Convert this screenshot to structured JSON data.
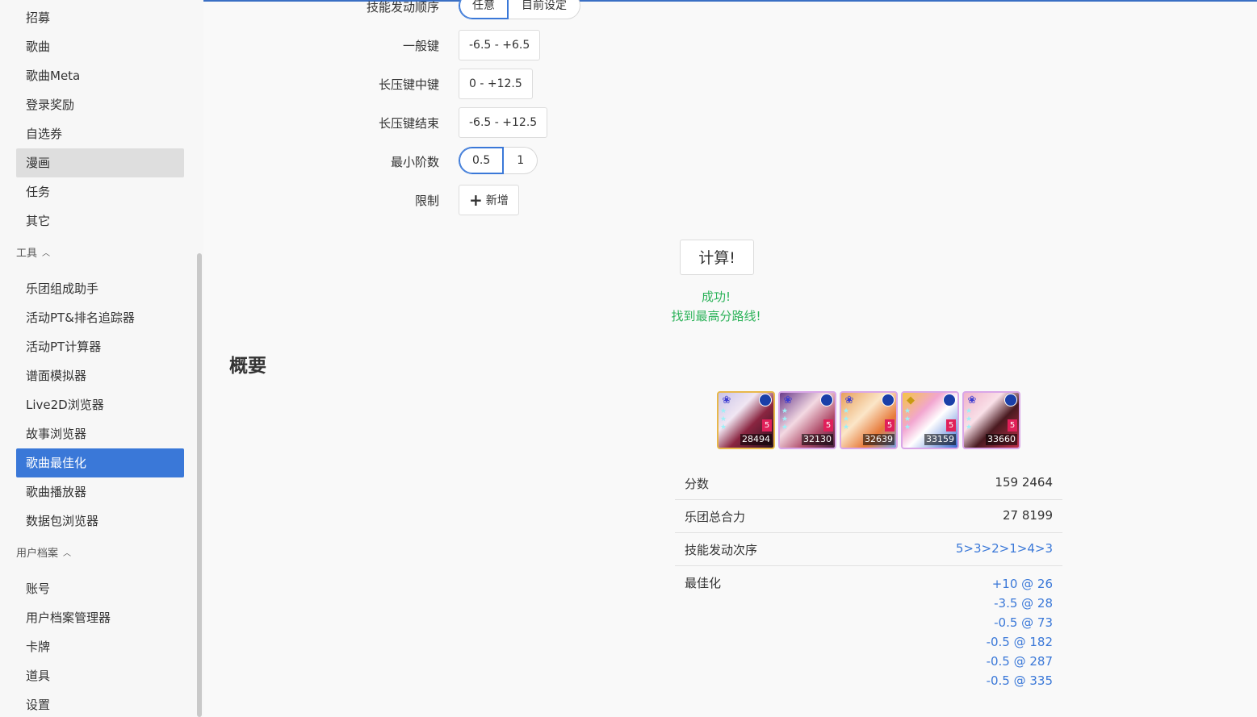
{
  "sidebar": {
    "items_top": [
      "招募",
      "歌曲",
      "歌曲Meta",
      "登录奖励",
      "自选券",
      "漫画",
      "任务",
      "其它"
    ],
    "section_tools": "工具",
    "items_tools": [
      "乐团组成助手",
      "活动PT&排名追踪器",
      "活动PT计算器",
      "谱面模拟器",
      "Live2D浏览器",
      "故事浏览器",
      "歌曲最佳化",
      "歌曲播放器",
      "数据包浏览器"
    ],
    "section_profile": "用户档案",
    "items_profile": [
      "账号",
      "用户档案管理器",
      "卡牌",
      "道具",
      "设置"
    ]
  },
  "form": {
    "skill_order_label": "技能发动顺序",
    "skill_order_options": [
      "任意",
      "目前设定"
    ],
    "normal_note_label": "一般键",
    "normal_note_value": "-6.5 - +6.5",
    "long_mid_label": "长压键中键",
    "long_mid_value": "0 - +12.5",
    "long_end_label": "长压键结束",
    "long_end_value": "-6.5 - +12.5",
    "min_step_label": "最小阶数",
    "min_step_options": [
      "0.5",
      "1"
    ],
    "limit_label": "限制",
    "add_label": "新增"
  },
  "calculate_label": "计算!",
  "status": {
    "line1": "成功!",
    "line2": "找到最高分路线!"
  },
  "summary": {
    "heading": "概要",
    "cards": [
      {
        "power": "28494",
        "rarity": "5"
      },
      {
        "power": "32130",
        "rarity": "5"
      },
      {
        "power": "32639",
        "rarity": "5"
      },
      {
        "power": "33159",
        "rarity": "5"
      },
      {
        "power": "33660",
        "rarity": "5"
      }
    ],
    "score_label": "分数",
    "score_value": "159 2464",
    "band_power_label": "乐团总合力",
    "band_power_value": "27 8199",
    "skill_order_label": "技能发动次序",
    "skill_order_value": "5>3>2>1>4>3",
    "optimize_label": "最佳化",
    "optimizations": [
      "+10 @ 26",
      "-3.5 @ 28",
      "-0.5 @ 73",
      "-0.5 @ 182",
      "-0.5 @ 287",
      "-0.5 @ 335"
    ]
  },
  "colors": {
    "accent": "#3a78d8",
    "success": "#2db35a"
  }
}
